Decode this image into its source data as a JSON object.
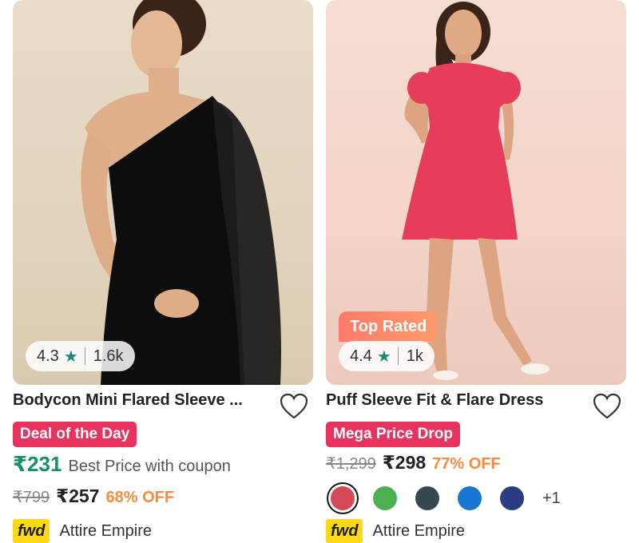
{
  "products": [
    {
      "rating": "4.3",
      "review_count": "1.6k",
      "title": "Bodycon Mini Flared Sleeve ...",
      "deal_label": "Deal of the Day",
      "coupon_price": "₹231",
      "coupon_text": "Best Price with coupon",
      "mrp": "₹799",
      "price": "₹257",
      "discount": "68% OFF",
      "seller_badge": "fwd",
      "seller": "Attire Empire",
      "colors": {
        "deal": "#e8335f",
        "coupon_price": "#14916a",
        "discount": "#ff8a3d"
      }
    },
    {
      "badge": "Top Rated",
      "rating": "4.4",
      "review_count": "1k",
      "title": "Puff Sleeve Fit & Flare Dress",
      "deal_label": "Mega Price Drop",
      "mrp": "₹1,299",
      "price": "₹298",
      "discount": "77% OFF",
      "swatches": [
        "#d64a57",
        "#4caf50",
        "#37474f",
        "#1976d2",
        "#283d85"
      ],
      "more_colors": "+1",
      "seller_badge": "fwd",
      "seller": "Attire Empire"
    }
  ],
  "icons": {
    "rating": "star-icon",
    "wishlist": "heart-icon"
  }
}
